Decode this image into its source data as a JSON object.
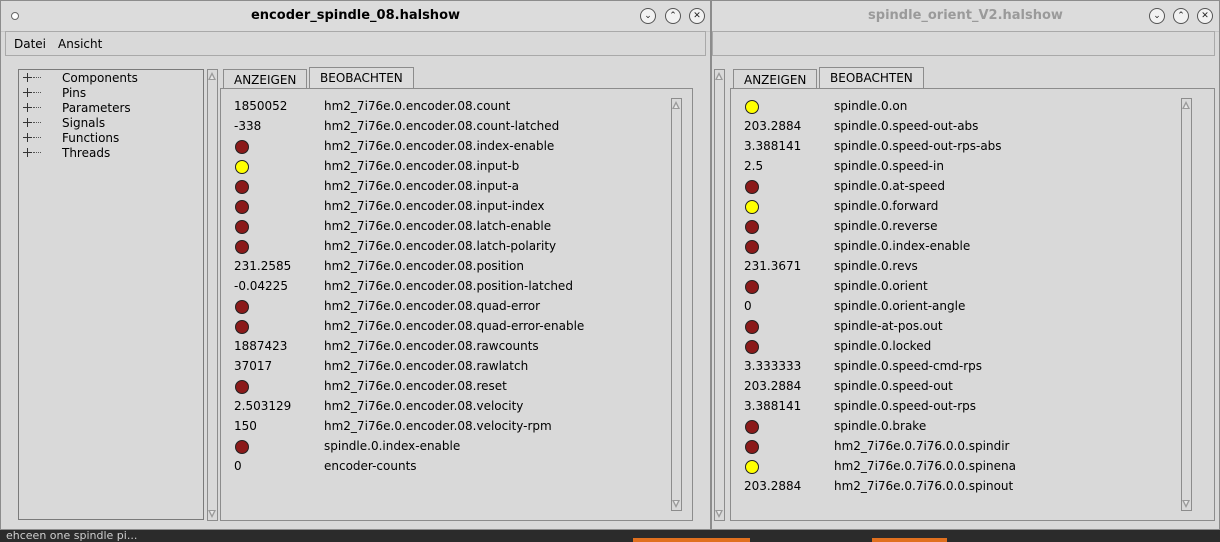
{
  "colors": {
    "led_on": "#ffff00",
    "led_off": "#8b1a1a",
    "window_bg": "#d9d9d9"
  },
  "background": {
    "partial_text": "ehceen one    spindle pi..."
  },
  "window1": {
    "title": "encoder_spindle_08.halshow",
    "buttons": [
      "chevron-down-icon",
      "chevron-up-icon",
      "close-icon"
    ],
    "menu": [
      "Datei",
      "Ansicht"
    ],
    "tree": [
      "Components",
      "Pins",
      "Parameters",
      "Signals",
      "Functions",
      "Threads"
    ],
    "tabs": [
      "ANZEIGEN",
      "BEOBACHTEN"
    ],
    "active_tab": "BEOBACHTEN",
    "watch": [
      {
        "type": "value",
        "value": "1850052",
        "name": "hm2_7i76e.0.encoder.08.count"
      },
      {
        "type": "value",
        "value": "-338",
        "name": "hm2_7i76e.0.encoder.08.count-latched"
      },
      {
        "type": "led",
        "state": "off",
        "name": "hm2_7i76e.0.encoder.08.index-enable"
      },
      {
        "type": "led",
        "state": "on",
        "name": "hm2_7i76e.0.encoder.08.input-b"
      },
      {
        "type": "led",
        "state": "off",
        "name": "hm2_7i76e.0.encoder.08.input-a"
      },
      {
        "type": "led",
        "state": "off",
        "name": "hm2_7i76e.0.encoder.08.input-index"
      },
      {
        "type": "led",
        "state": "off",
        "name": "hm2_7i76e.0.encoder.08.latch-enable"
      },
      {
        "type": "led",
        "state": "off",
        "name": "hm2_7i76e.0.encoder.08.latch-polarity"
      },
      {
        "type": "value",
        "value": "231.2585",
        "name": "hm2_7i76e.0.encoder.08.position"
      },
      {
        "type": "value",
        "value": "-0.04225",
        "name": "hm2_7i76e.0.encoder.08.position-latched"
      },
      {
        "type": "led",
        "state": "off",
        "name": "hm2_7i76e.0.encoder.08.quad-error"
      },
      {
        "type": "led",
        "state": "off",
        "name": "hm2_7i76e.0.encoder.08.quad-error-enable"
      },
      {
        "type": "value",
        "value": "1887423",
        "name": "hm2_7i76e.0.encoder.08.rawcounts"
      },
      {
        "type": "value",
        "value": "37017",
        "name": "hm2_7i76e.0.encoder.08.rawlatch"
      },
      {
        "type": "led",
        "state": "off",
        "name": "hm2_7i76e.0.encoder.08.reset"
      },
      {
        "type": "value",
        "value": "2.503129",
        "name": "hm2_7i76e.0.encoder.08.velocity"
      },
      {
        "type": "value",
        "value": "150",
        "name": "hm2_7i76e.0.encoder.08.velocity-rpm"
      },
      {
        "type": "led",
        "state": "off",
        "name": "spindle.0.index-enable"
      },
      {
        "type": "value",
        "value": "0",
        "name": "encoder-counts"
      }
    ]
  },
  "window2": {
    "title": "spindle_orient_V2.halshow",
    "buttons": [
      "chevron-down-icon",
      "chevron-up-icon",
      "close-icon"
    ],
    "tabs": [
      "ANZEIGEN",
      "BEOBACHTEN"
    ],
    "active_tab": "BEOBACHTEN",
    "watch": [
      {
        "type": "led",
        "state": "on",
        "name": "spindle.0.on"
      },
      {
        "type": "value",
        "value": "203.2884",
        "name": "spindle.0.speed-out-abs"
      },
      {
        "type": "value",
        "value": "3.388141",
        "name": "spindle.0.speed-out-rps-abs"
      },
      {
        "type": "value",
        "value": "2.5",
        "name": "spindle.0.speed-in"
      },
      {
        "type": "led",
        "state": "off",
        "name": "spindle.0.at-speed"
      },
      {
        "type": "led",
        "state": "on",
        "name": "spindle.0.forward"
      },
      {
        "type": "led",
        "state": "off",
        "name": "spindle.0.reverse"
      },
      {
        "type": "led",
        "state": "off",
        "name": "spindle.0.index-enable"
      },
      {
        "type": "value",
        "value": "231.3671",
        "name": "spindle.0.revs"
      },
      {
        "type": "led",
        "state": "off",
        "name": "spindle.0.orient"
      },
      {
        "type": "value",
        "value": "0",
        "name": "spindle.0.orient-angle"
      },
      {
        "type": "led",
        "state": "off",
        "name": "spindle-at-pos.out"
      },
      {
        "type": "led",
        "state": "off",
        "name": "spindle.0.locked"
      },
      {
        "type": "value",
        "value": "3.333333",
        "name": "spindle.0.speed-cmd-rps"
      },
      {
        "type": "value",
        "value": "203.2884",
        "name": "spindle.0.speed-out"
      },
      {
        "type": "value",
        "value": "3.388141",
        "name": "spindle.0.speed-out-rps"
      },
      {
        "type": "led",
        "state": "off",
        "name": "spindle.0.brake"
      },
      {
        "type": "led",
        "state": "off",
        "name": "hm2_7i76e.0.7i76.0.0.spindir"
      },
      {
        "type": "led",
        "state": "on",
        "name": "hm2_7i76e.0.7i76.0.0.spinena"
      },
      {
        "type": "value",
        "value": "203.2884",
        "name": "hm2_7i76e.0.7i76.0.0.spinout"
      }
    ]
  }
}
